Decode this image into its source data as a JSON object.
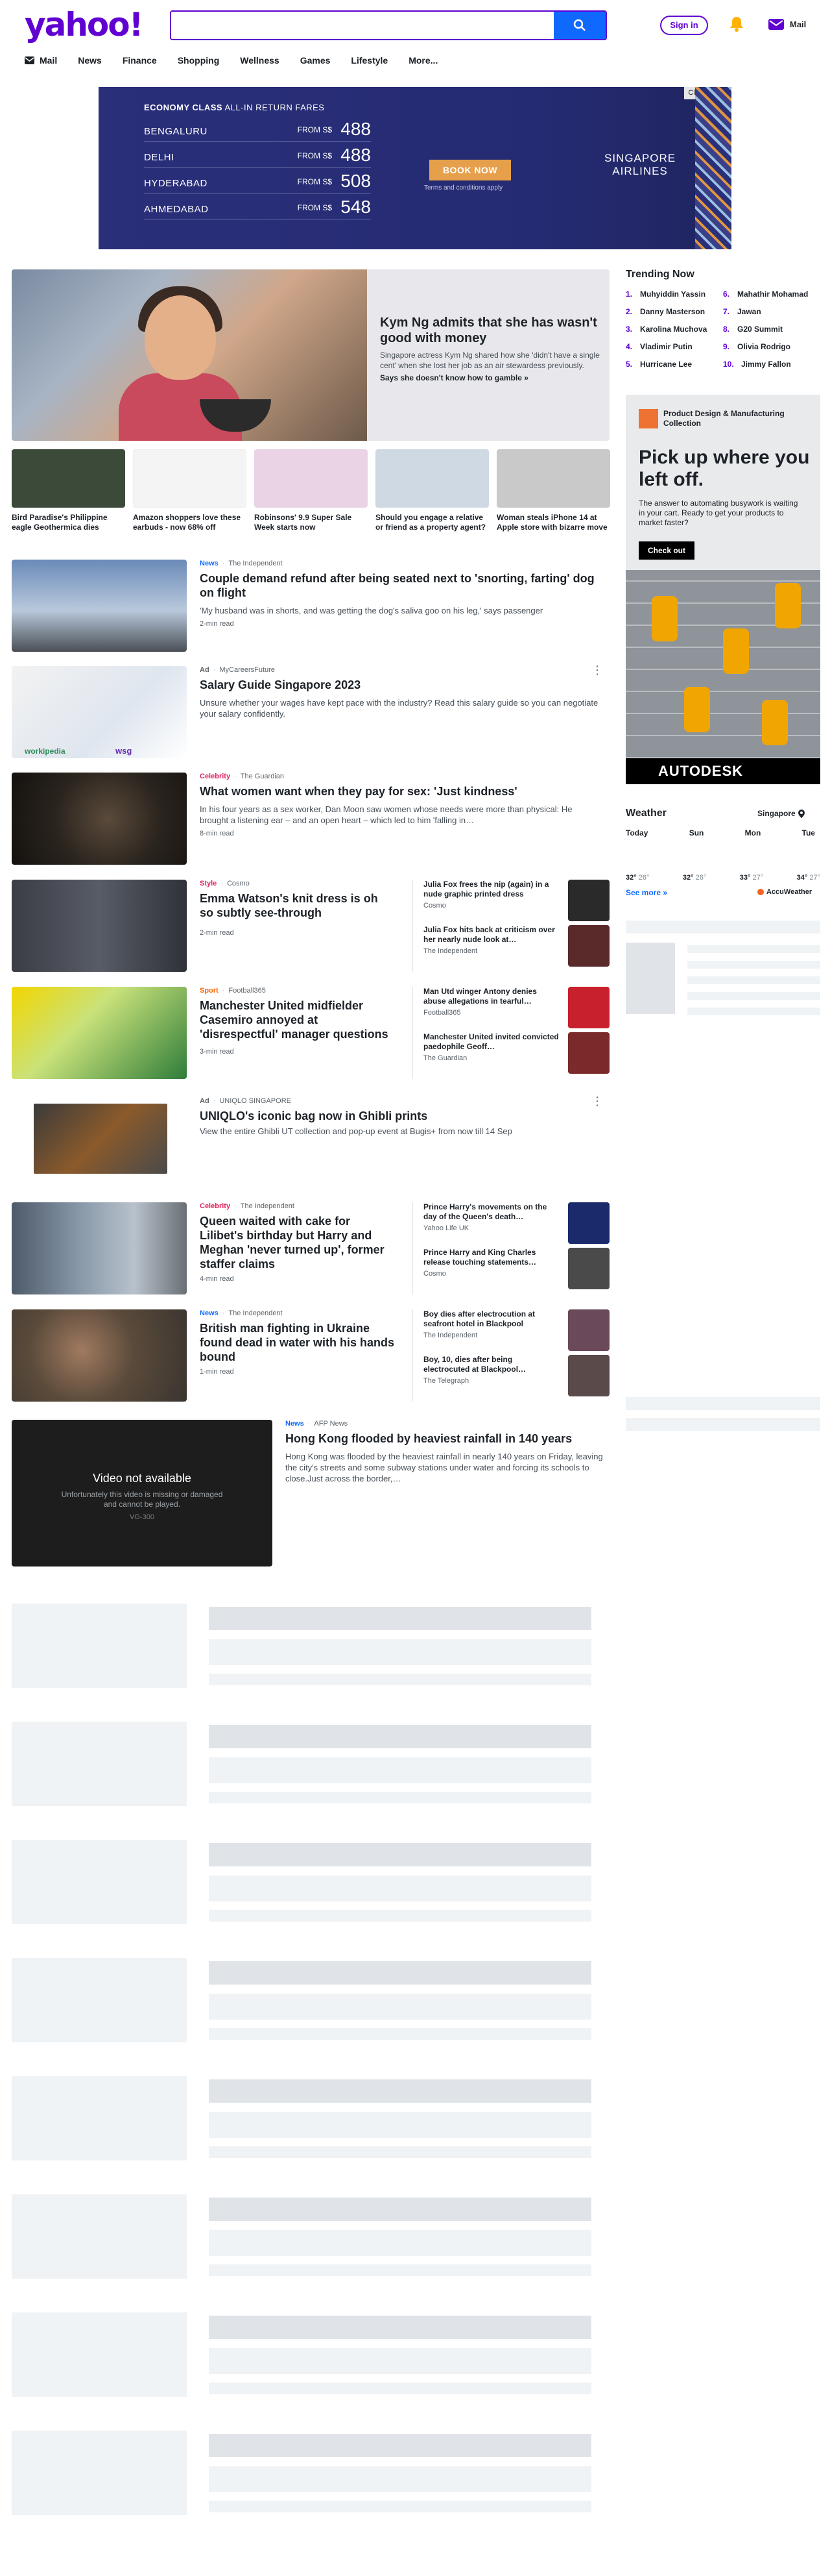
{
  "header": {
    "logo": "yahoo!",
    "search_placeholder": "",
    "signin_label": "Sign in",
    "mail_label": "Mail"
  },
  "nav": [
    {
      "label": "Mail",
      "icon": "mail-icon"
    },
    {
      "label": "News"
    },
    {
      "label": "Finance"
    },
    {
      "label": "Shopping"
    },
    {
      "label": "Wellness"
    },
    {
      "label": "Games"
    },
    {
      "label": "Lifestyle"
    },
    {
      "label": "More..."
    }
  ],
  "ad_banner": {
    "close_label": "Close ad",
    "class_bold": "ECONOMY CLASS",
    "class_rest": " ALL-IN RETURN FARES",
    "fares": [
      {
        "city": "BENGALURU",
        "from": "FROM S$",
        "price": "488"
      },
      {
        "city": "DELHI",
        "from": "FROM S$",
        "price": "488"
      },
      {
        "city": "HYDERABAD",
        "from": "FROM S$",
        "price": "508"
      },
      {
        "city": "AHMEDABAD",
        "from": "FROM S$",
        "price": "548"
      }
    ],
    "book_label": "BOOK NOW",
    "terms": "Terms and conditions apply",
    "brand_line1": "SINGAPORE",
    "brand_line2": "AIRLINES"
  },
  "hero": {
    "title": "Kym Ng admits that she has wasn't good with money",
    "desc": "Singapore actress Kym Ng shared how she 'didn't have a single cent' when she lost her job as an air stewardess previously.",
    "link": "Says she doesn't know how to gamble »"
  },
  "thumbs": [
    {
      "title": "Bird Paradise's Philippine eagle Geothermica dies",
      "color": "#3c4a3a"
    },
    {
      "title": "Amazon shoppers love these earbuds - now 68% off",
      "color": "#f4f4f4"
    },
    {
      "title": "Robinsons' 9.9 Super Sale Week starts now",
      "color": "#e9d3e4"
    },
    {
      "title": "Should you engage a relative or friend as a property agent?",
      "color": "#cfd9e4"
    },
    {
      "title": "Woman steals iPhone 14 at Apple store with bizarre move",
      "color": "#c9c9c9"
    }
  ],
  "stories": {
    "s1": {
      "cat": "News",
      "source": "The Independent",
      "title": "Couple demand refund after being seated next to 'snorting, farting' dog on flight",
      "desc": "'My husband was in shorts, and was getting the dog's saliva goo on his leg,' says passenger",
      "read": "2-min read"
    },
    "s2": {
      "cat": "Ad",
      "source": "MyCareersFuture",
      "title": "Salary Guide Singapore 2023",
      "desc": "Unsure whether your wages have kept pace with the industry? Read this salary guide so you can negotiate your salary confidently.",
      "logo1": "workipedia",
      "logo2": "wsg"
    },
    "s3": {
      "cat": "Celebrity",
      "source": "The Guardian",
      "title": "What women want when they pay for sex: 'Just kindness'",
      "desc": "In his four years as a sex worker, Dan Moon saw women whose needs were more than physical: He brought a listening ear – and an open heart – which led to him 'falling in…",
      "read": "8-min read"
    },
    "s4": {
      "cat": "Style",
      "source": "Cosmo",
      "title": "Emma Watson's knit dress is oh so subtly see-through",
      "read": "2-min read",
      "side": [
        {
          "text": "Julia Fox frees the nip (again) in a nude graphic printed dress",
          "source": "Cosmo",
          "color": "#2a2a2a"
        },
        {
          "text": "Julia Fox hits back at criticism over her nearly nude look at…",
          "source": "The Independent",
          "color": "#5a2a2a"
        }
      ]
    },
    "s5": {
      "cat": "Sport",
      "source": "Football365",
      "title": "Manchester United midfielder Casemiro annoyed at 'disrespectful' manager questions",
      "read": "3-min read",
      "side": [
        {
          "text": "Man Utd winger Antony denies abuse allegations in tearful…",
          "source": "Football365",
          "color": "#c8202c"
        },
        {
          "text": "Manchester United invited convicted paedophile Geoff…",
          "source": "The Guardian",
          "color": "#7a2a2a"
        }
      ]
    },
    "s6": {
      "cat": "Ad",
      "source": "UNIQLO SINGAPORE",
      "title": "UNIQLO's iconic bag now in Ghibli prints",
      "desc": "View the entire Ghibli UT collection and pop-up event at Bugis+ from now till 14 Sep"
    },
    "s7": {
      "cat": "Celebrity",
      "source": "The Independent",
      "title": "Queen waited with cake for Lilibet's birthday but Harry and Meghan 'never turned up', former staffer claims",
      "read": "4-min read",
      "side": [
        {
          "text": "Prince Harry's movements on the day of the Queen's death…",
          "source": "Yahoo Life UK",
          "color": "#1b2a6a"
        },
        {
          "text": "Prince Harry and King Charles release touching statements…",
          "source": "Cosmo",
          "color": "#4a4a4a"
        }
      ]
    },
    "s8": {
      "cat": "News",
      "source": "The Independent",
      "title": "British man fighting in Ukraine found dead in water with his hands bound",
      "read": "1-min read",
      "side": [
        {
          "text": "Boy dies after electrocution at seafront hotel in Blackpool",
          "source": "The Independent",
          "color": "#6a4a5a"
        },
        {
          "text": "Boy, 10, dies after being electrocuted at Blackpool…",
          "source": "The Telegraph",
          "color": "#5a4a4a"
        }
      ]
    },
    "s9": {
      "cat": "News",
      "source": "AFP News",
      "title": "Hong Kong flooded by heaviest rainfall in 140 years",
      "desc": "Hong Kong was flooded by the heaviest rainfall in nearly 140 years on Friday, leaving the city's streets and some subway stations under water and forcing its schools to close.Just across the border,…",
      "video_na": "Video not available",
      "video_sub": "Unfortunately this video is missing or damaged and cannot be played.",
      "video_code": "VG-300"
    }
  },
  "trending": {
    "title": "Trending Now",
    "items": [
      {
        "n": "1.",
        "label": "Muhyiddin Yassin"
      },
      {
        "n": "2.",
        "label": "Danny Masterson"
      },
      {
        "n": "3.",
        "label": "Karolina Muchova"
      },
      {
        "n": "4.",
        "label": "Vladimir Putin"
      },
      {
        "n": "5.",
        "label": "Hurricane Lee"
      },
      {
        "n": "6.",
        "label": "Mahathir Mohamad"
      },
      {
        "n": "7.",
        "label": "Jawan"
      },
      {
        "n": "8.",
        "label": "G20 Summit"
      },
      {
        "n": "9.",
        "label": "Olivia Rodrigo"
      },
      {
        "n": "10.",
        "label": "Jimmy Fallon"
      }
    ]
  },
  "autodesk_ad": {
    "product": "Product Design & Manufacturing Collection",
    "headline": "Pick up where you left off.",
    "sub": "The answer to automating busywork is waiting in your cart. Ready to get your products to market faster?",
    "cta": "Check out",
    "brand": "AUTODESK"
  },
  "weather": {
    "title": "Weather",
    "location": "Singapore",
    "days": [
      {
        "day": "Today",
        "hi": "32°",
        "lo": "26°"
      },
      {
        "day": "Sun",
        "hi": "32°",
        "lo": "26°"
      },
      {
        "day": "Mon",
        "hi": "33°",
        "lo": "27°"
      },
      {
        "day": "Tue",
        "hi": "34°",
        "lo": "27°"
      }
    ],
    "see_more": "See more »",
    "provider": "AccuWeather"
  },
  "colors": {
    "brand": "#6001d2",
    "accent": "#0f69ff",
    "celebrity": "#e0245e",
    "style": "#e0245e",
    "sport": "#ff6600",
    "news": "#0f69ff"
  }
}
